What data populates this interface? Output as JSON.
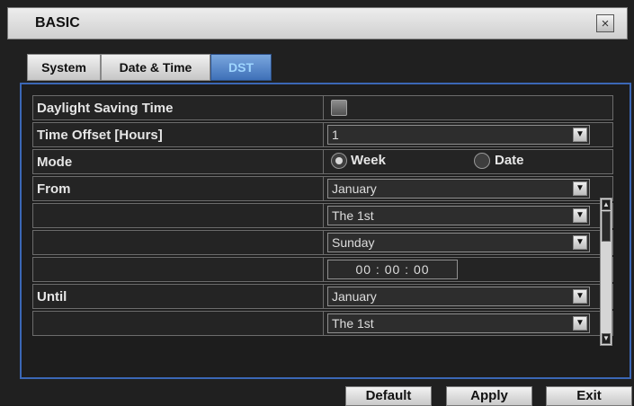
{
  "window": {
    "title": "BASIC",
    "close_icon": "×"
  },
  "tabs": [
    {
      "label": "System"
    },
    {
      "label": "Date & Time"
    },
    {
      "label": "DST"
    }
  ],
  "rows": {
    "daylight_saving_time": {
      "label": "Daylight Saving Time"
    },
    "time_offset": {
      "label": "Time Offset [Hours]",
      "value": "1"
    },
    "mode": {
      "label": "Mode",
      "option_week": "Week",
      "option_date": "Date",
      "selected": "Week"
    },
    "from": {
      "label": "From",
      "month": "January",
      "week": "The 1st",
      "day": "Sunday",
      "time": "00 : 00 : 00"
    },
    "until": {
      "label": "Until",
      "month": "January",
      "week": "The 1st"
    }
  },
  "buttons": {
    "default": "Default",
    "apply": "Apply",
    "exit": "Exit"
  },
  "icons": {
    "dropdown": "▼",
    "scroll_up": "▲",
    "scroll_down": "▼"
  }
}
